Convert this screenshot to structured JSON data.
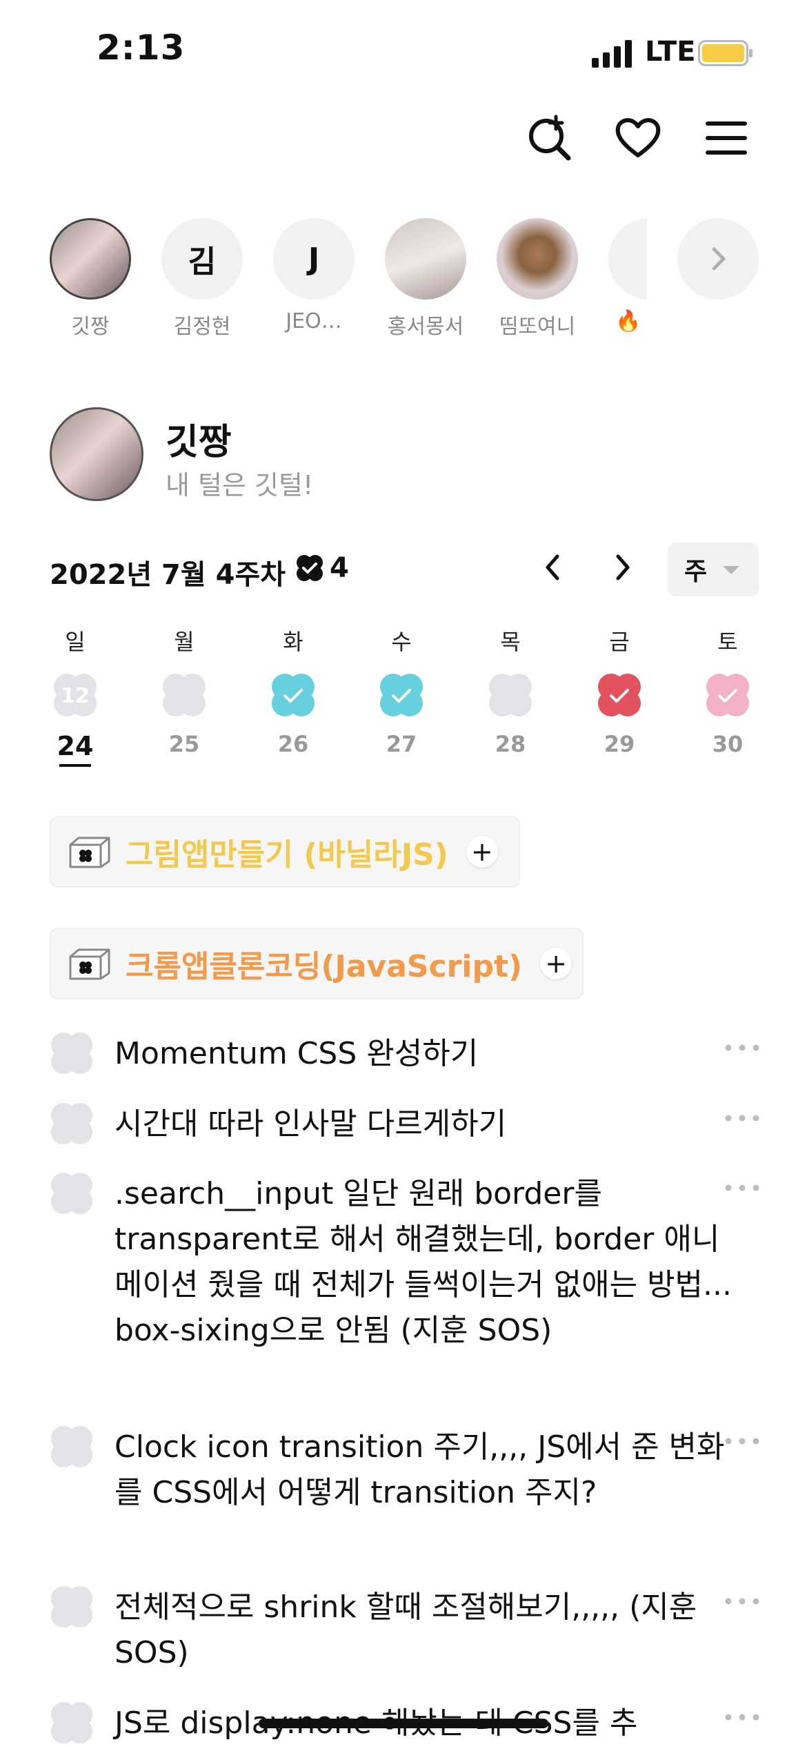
{
  "status_bar": {
    "time": "2:13",
    "network": "LTE",
    "battery_color": "#f7cd46"
  },
  "top_icons": [
    "search-plus-icon",
    "heart-icon",
    "menu-icon"
  ],
  "stories": [
    {
      "initial": "",
      "name": "깃짱",
      "type": "photo"
    },
    {
      "initial": "김",
      "name": "김정현",
      "type": "initial"
    },
    {
      "initial": "J",
      "name": "JEO…",
      "type": "initial"
    },
    {
      "initial": "",
      "name": "홍서몽서",
      "type": "photo"
    },
    {
      "initial": "",
      "name": "띰또여니",
      "type": "photo"
    },
    {
      "initial": "🔥",
      "name": "🔥 ",
      "type": "emoji"
    }
  ],
  "profile": {
    "name": "깃짱",
    "bio": "내 털은 깃털!"
  },
  "week": {
    "label": "2022년 7월 4주차",
    "done_count": "4",
    "mode": "주",
    "days": [
      {
        "dn": "일",
        "date": "24",
        "badge": "12",
        "color": "#e1e3e6",
        "check": false,
        "today": true
      },
      {
        "dn": "월",
        "date": "25",
        "badge": "",
        "color": "#e1e3e6",
        "check": false,
        "today": false
      },
      {
        "dn": "화",
        "date": "26",
        "badge": "",
        "color": "#66d0df",
        "check": true,
        "today": false
      },
      {
        "dn": "수",
        "date": "27",
        "badge": "",
        "color": "#66d0df",
        "check": true,
        "today": false
      },
      {
        "dn": "목",
        "date": "28",
        "badge": "",
        "color": "#e1e3e6",
        "check": false,
        "today": false
      },
      {
        "dn": "금",
        "date": "29",
        "badge": "",
        "color": "#e3525f",
        "check": true,
        "today": false
      },
      {
        "dn": "토",
        "date": "30",
        "badge": "",
        "color": "#f3b1c5",
        "check": true,
        "today": false
      }
    ]
  },
  "categories": [
    {
      "name": "그림앱만들기 (바닐라JS)",
      "color": "#f2c94c"
    },
    {
      "name": "크롬앱클론코딩(JavaScript)",
      "color": "#f2994a"
    }
  ],
  "todos": [
    {
      "text": "Momentum CSS 완성하기"
    },
    {
      "text": "시간대 따라 인사말 다르게하기"
    },
    {
      "text": ".search__input 일단 원래 border를 transparent로 해서 해결했는데, border 애니메이션 줬을 때 전체가 들썩이는거 없애는 방법... box-sixing으로 안됨 (지훈 SOS)"
    },
    {
      "text": "Clock icon transition 주기,,,, JS에서 준 변화를 CSS에서 어떻게 transition 주지?"
    },
    {
      "text": "전체적으로 shrink 할때 조절해보기,,,,, (지훈 SOS)"
    },
    {
      "text": "JS로 display:none 해놨는 데 CSS를 추"
    }
  ]
}
